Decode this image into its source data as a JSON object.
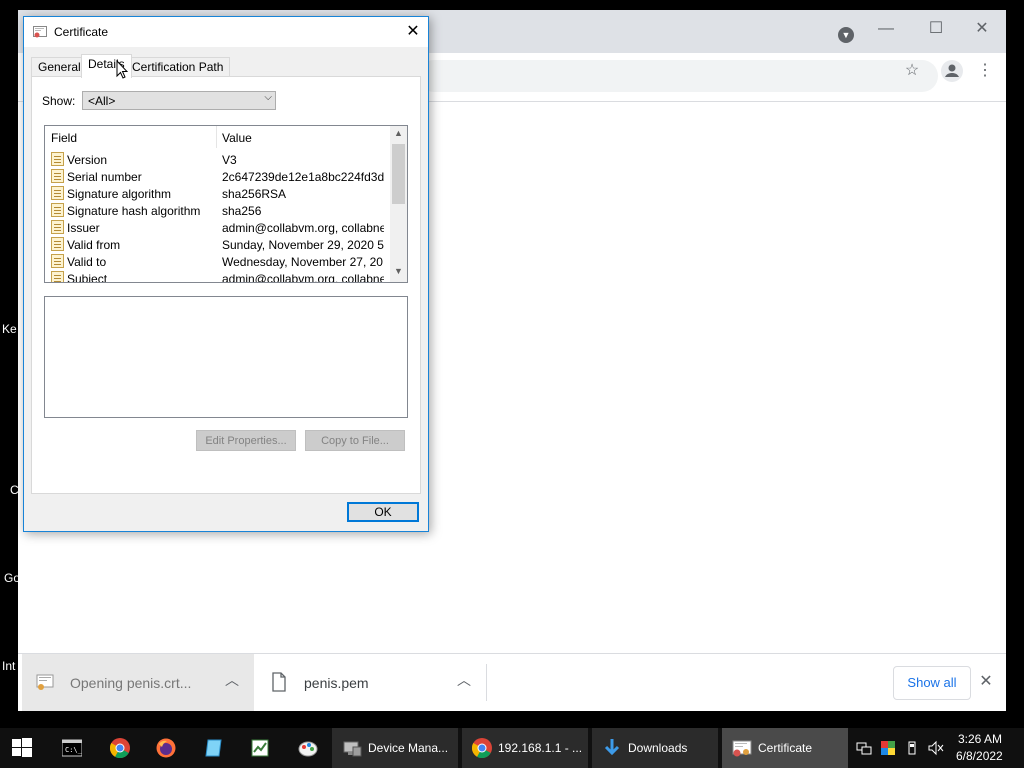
{
  "desktop": {
    "labels": [
      "Ke",
      "C",
      "Go",
      "Int"
    ]
  },
  "chrome": {
    "downloads": [
      {
        "name": "Opening penis.crt..."
      },
      {
        "name": "penis.pem"
      }
    ],
    "show_all_label": "Show all"
  },
  "dialog": {
    "title": "Certificate",
    "tabs": [
      {
        "label": "General"
      },
      {
        "label": "Details"
      },
      {
        "label": "Certification Path"
      }
    ],
    "show_label": "Show:",
    "show_value": "<All>",
    "columns": {
      "field": "Field",
      "value": "Value"
    },
    "rows": [
      {
        "field": "Version",
        "value": "V3"
      },
      {
        "field": "Serial number",
        "value": "2c647239de12e1a8bc224fd3d..."
      },
      {
        "field": "Signature algorithm",
        "value": "sha256RSA"
      },
      {
        "field": "Signature hash algorithm",
        "value": "sha256"
      },
      {
        "field": "Issuer",
        "value": "admin@collabvm.org, collabne..."
      },
      {
        "field": "Valid from",
        "value": "Sunday, November 29, 2020 5..."
      },
      {
        "field": "Valid to",
        "value": "Wednesday, November 27, 20..."
      },
      {
        "field": "Subject",
        "value": "admin@collabvm.org, collabne..."
      }
    ],
    "edit_properties_label": "Edit Properties...",
    "copy_to_file_label": "Copy to File...",
    "ok_label": "OK"
  },
  "taskbar": {
    "tasks": [
      {
        "label": "Device Mana..."
      },
      {
        "label": "192.168.1.1 - ..."
      },
      {
        "label": "Downloads"
      },
      {
        "label": "Certificate"
      }
    ],
    "time": "3:26 AM",
    "date": "6/8/2022"
  },
  "colors": {
    "accent": "#0078d7",
    "dialog_border": "#1883d7",
    "link_blue": "#1a73e8"
  }
}
